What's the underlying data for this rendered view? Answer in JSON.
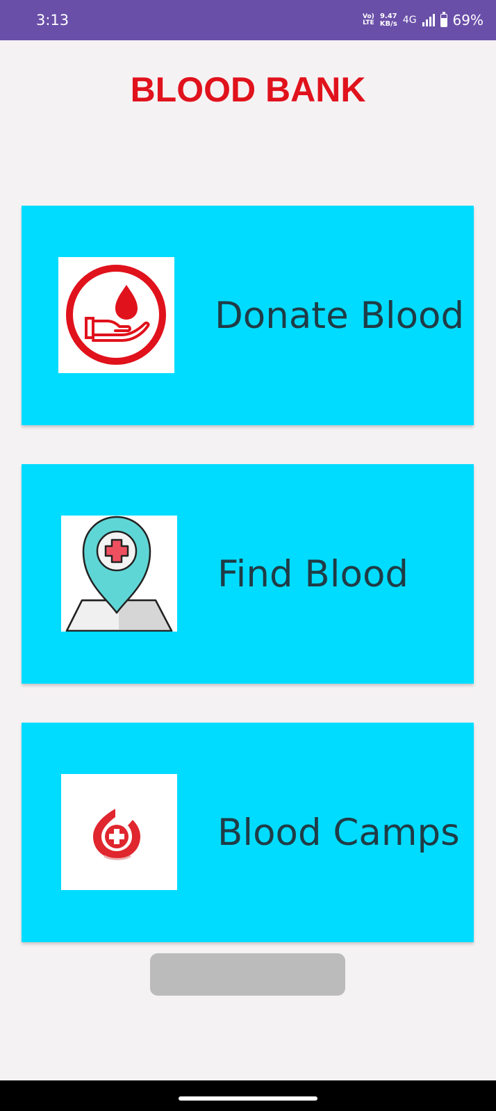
{
  "status_bar": {
    "time": "3:13",
    "volte_top": "Vo)",
    "volte_bottom": "LTE",
    "net_speed_value": "9.47",
    "net_speed_unit": "KB/s",
    "network_type": "4G",
    "battery_level_percent": 69,
    "battery_text": "69%",
    "icons": [
      "volte-icon",
      "signal-icon",
      "battery-icon"
    ]
  },
  "app": {
    "title": "BLOOD BANK",
    "title_color": "#e0121c"
  },
  "cards": [
    {
      "label": "Donate Blood",
      "icon": "donate-blood-icon"
    },
    {
      "label": "Find Blood",
      "icon": "find-blood-location-icon"
    },
    {
      "label": "Blood Camps",
      "icon": "blood-camps-icon"
    }
  ],
  "colors": {
    "status_bar": "#6a4fa8",
    "card_background": "#00dcff",
    "card_text": "#1f3c46",
    "page_background": "#f5f2f4",
    "bottom_button": "#bcbbbc"
  }
}
